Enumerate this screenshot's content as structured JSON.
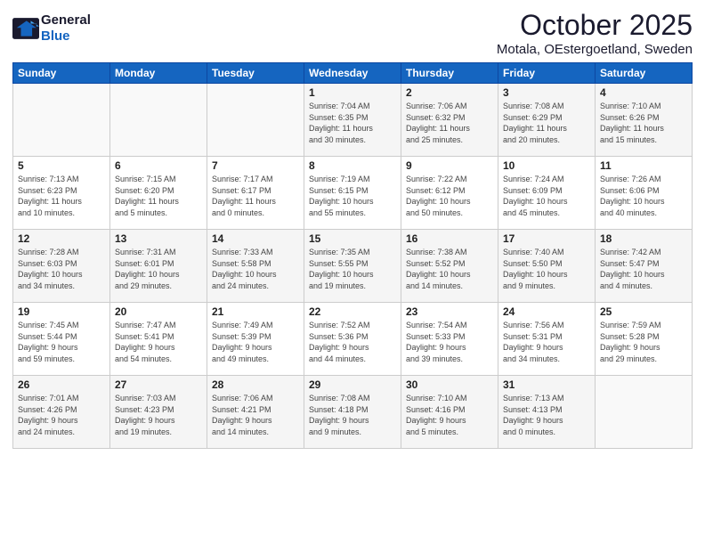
{
  "header": {
    "logo_line1": "General",
    "logo_line2": "Blue",
    "title": "October 2025",
    "subtitle": "Motala, OEstergoetland, Sweden"
  },
  "days_of_week": [
    "Sunday",
    "Monday",
    "Tuesday",
    "Wednesday",
    "Thursday",
    "Friday",
    "Saturday"
  ],
  "weeks": [
    [
      {
        "day": "",
        "info": ""
      },
      {
        "day": "",
        "info": ""
      },
      {
        "day": "",
        "info": ""
      },
      {
        "day": "1",
        "info": "Sunrise: 7:04 AM\nSunset: 6:35 PM\nDaylight: 11 hours\nand 30 minutes."
      },
      {
        "day": "2",
        "info": "Sunrise: 7:06 AM\nSunset: 6:32 PM\nDaylight: 11 hours\nand 25 minutes."
      },
      {
        "day": "3",
        "info": "Sunrise: 7:08 AM\nSunset: 6:29 PM\nDaylight: 11 hours\nand 20 minutes."
      },
      {
        "day": "4",
        "info": "Sunrise: 7:10 AM\nSunset: 6:26 PM\nDaylight: 11 hours\nand 15 minutes."
      }
    ],
    [
      {
        "day": "5",
        "info": "Sunrise: 7:13 AM\nSunset: 6:23 PM\nDaylight: 11 hours\nand 10 minutes."
      },
      {
        "day": "6",
        "info": "Sunrise: 7:15 AM\nSunset: 6:20 PM\nDaylight: 11 hours\nand 5 minutes."
      },
      {
        "day": "7",
        "info": "Sunrise: 7:17 AM\nSunset: 6:17 PM\nDaylight: 11 hours\nand 0 minutes."
      },
      {
        "day": "8",
        "info": "Sunrise: 7:19 AM\nSunset: 6:15 PM\nDaylight: 10 hours\nand 55 minutes."
      },
      {
        "day": "9",
        "info": "Sunrise: 7:22 AM\nSunset: 6:12 PM\nDaylight: 10 hours\nand 50 minutes."
      },
      {
        "day": "10",
        "info": "Sunrise: 7:24 AM\nSunset: 6:09 PM\nDaylight: 10 hours\nand 45 minutes."
      },
      {
        "day": "11",
        "info": "Sunrise: 7:26 AM\nSunset: 6:06 PM\nDaylight: 10 hours\nand 40 minutes."
      }
    ],
    [
      {
        "day": "12",
        "info": "Sunrise: 7:28 AM\nSunset: 6:03 PM\nDaylight: 10 hours\nand 34 minutes."
      },
      {
        "day": "13",
        "info": "Sunrise: 7:31 AM\nSunset: 6:01 PM\nDaylight: 10 hours\nand 29 minutes."
      },
      {
        "day": "14",
        "info": "Sunrise: 7:33 AM\nSunset: 5:58 PM\nDaylight: 10 hours\nand 24 minutes."
      },
      {
        "day": "15",
        "info": "Sunrise: 7:35 AM\nSunset: 5:55 PM\nDaylight: 10 hours\nand 19 minutes."
      },
      {
        "day": "16",
        "info": "Sunrise: 7:38 AM\nSunset: 5:52 PM\nDaylight: 10 hours\nand 14 minutes."
      },
      {
        "day": "17",
        "info": "Sunrise: 7:40 AM\nSunset: 5:50 PM\nDaylight: 10 hours\nand 9 minutes."
      },
      {
        "day": "18",
        "info": "Sunrise: 7:42 AM\nSunset: 5:47 PM\nDaylight: 10 hours\nand 4 minutes."
      }
    ],
    [
      {
        "day": "19",
        "info": "Sunrise: 7:45 AM\nSunset: 5:44 PM\nDaylight: 9 hours\nand 59 minutes."
      },
      {
        "day": "20",
        "info": "Sunrise: 7:47 AM\nSunset: 5:41 PM\nDaylight: 9 hours\nand 54 minutes."
      },
      {
        "day": "21",
        "info": "Sunrise: 7:49 AM\nSunset: 5:39 PM\nDaylight: 9 hours\nand 49 minutes."
      },
      {
        "day": "22",
        "info": "Sunrise: 7:52 AM\nSunset: 5:36 PM\nDaylight: 9 hours\nand 44 minutes."
      },
      {
        "day": "23",
        "info": "Sunrise: 7:54 AM\nSunset: 5:33 PM\nDaylight: 9 hours\nand 39 minutes."
      },
      {
        "day": "24",
        "info": "Sunrise: 7:56 AM\nSunset: 5:31 PM\nDaylight: 9 hours\nand 34 minutes."
      },
      {
        "day": "25",
        "info": "Sunrise: 7:59 AM\nSunset: 5:28 PM\nDaylight: 9 hours\nand 29 minutes."
      }
    ],
    [
      {
        "day": "26",
        "info": "Sunrise: 7:01 AM\nSunset: 4:26 PM\nDaylight: 9 hours\nand 24 minutes."
      },
      {
        "day": "27",
        "info": "Sunrise: 7:03 AM\nSunset: 4:23 PM\nDaylight: 9 hours\nand 19 minutes."
      },
      {
        "day": "28",
        "info": "Sunrise: 7:06 AM\nSunset: 4:21 PM\nDaylight: 9 hours\nand 14 minutes."
      },
      {
        "day": "29",
        "info": "Sunrise: 7:08 AM\nSunset: 4:18 PM\nDaylight: 9 hours\nand 9 minutes."
      },
      {
        "day": "30",
        "info": "Sunrise: 7:10 AM\nSunset: 4:16 PM\nDaylight: 9 hours\nand 5 minutes."
      },
      {
        "day": "31",
        "info": "Sunrise: 7:13 AM\nSunset: 4:13 PM\nDaylight: 9 hours\nand 0 minutes."
      },
      {
        "day": "",
        "info": ""
      }
    ]
  ]
}
